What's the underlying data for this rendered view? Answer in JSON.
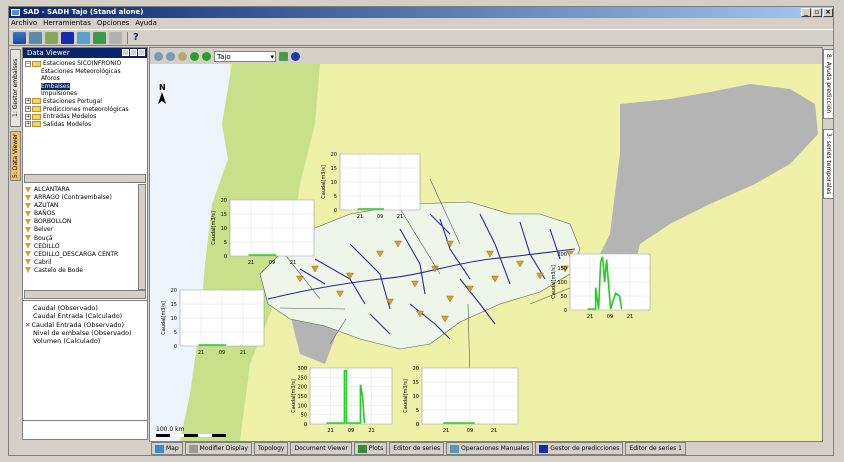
{
  "title": "SAD - SADH Tajo (Stand alone)",
  "menu": [
    "Archivo",
    "Herramientas",
    "Opciones",
    "Ayuda"
  ],
  "help_label": "?",
  "left_tabs": [
    "1: Gestor embalses",
    "5: Data Viewer"
  ],
  "right_tabs": [
    "8: Ayuda predicción",
    "3: series temporales"
  ],
  "data_viewer": {
    "title": "Data Viewer",
    "tree": [
      {
        "label": "Estaciones SICOINFRONIO",
        "expander": "−"
      },
      {
        "label": "Estaciones Meteorológicas"
      },
      {
        "label": "Aforos"
      },
      {
        "label": "Embalses",
        "selected": true
      },
      {
        "label": "Impulsiones"
      },
      {
        "label": "Estaciones Portugal",
        "expander": "+"
      },
      {
        "label": "Predicciones meteorológicas",
        "expander": "+"
      },
      {
        "label": "Entradas Modelos",
        "expander": "+"
      },
      {
        "label": "Salidas Modelos",
        "expander": "+"
      }
    ],
    "stations": [
      "ALCANTARA",
      "ARRAGO (Contraembalse)",
      "AZUTAN",
      "BAÑOS",
      "BORBOLLON",
      "Belver",
      "Bouçã",
      "CEDILLO",
      "CEDILLO_DESCARGA CENTR",
      "Cabril",
      "Castelo de Bode"
    ],
    "variables": [
      {
        "label": "Caudal (Observado)",
        "checked": false
      },
      {
        "label": "Caudal Entrada (Calculado)",
        "checked": false
      },
      {
        "label": "Caudal Entrada (Observado)",
        "checked": true,
        "mark": "✕"
      },
      {
        "label": "Nivel de embalse (Observado)",
        "checked": false
      },
      {
        "label": "Volumen (Calculado)",
        "checked": false
      }
    ]
  },
  "map": {
    "region_select": "Tajo",
    "north_label": "N",
    "scale_label": "100.0 km",
    "colors": {
      "sea": "#eef4fb",
      "land_yellow": "#eef2a8",
      "land_green": "#c8e08a",
      "gray": "#b4b4b4",
      "basin": "#eef6ea",
      "river": "#2a2a9a",
      "station": "#d9a030"
    },
    "ylabel": "Caudal[m3/s]",
    "insets": [
      {
        "yticks": [
          "0",
          "5",
          "10",
          "15",
          "20"
        ],
        "xticks": [
          "21",
          "09",
          "21"
        ],
        "kind": "flat"
      },
      {
        "yticks": [
          "0",
          "5",
          "10",
          "15",
          "20"
        ],
        "xticks": [
          "21",
          "09",
          "21"
        ],
        "kind": "flat"
      },
      {
        "yticks": [
          "0",
          "50",
          "100",
          "150",
          "200"
        ],
        "xticks": [
          "21",
          "09",
          "21"
        ],
        "kind": "spiky"
      },
      {
        "yticks": [
          "0",
          "5",
          "10",
          "15",
          "20"
        ],
        "xticks": [
          "21",
          "09",
          "21"
        ],
        "kind": "flat"
      },
      {
        "yticks": [
          "0",
          "50",
          "100",
          "150",
          "200",
          "250",
          "300"
        ],
        "xticks": [
          "21",
          "09",
          "21"
        ],
        "kind": "spike"
      },
      {
        "yticks": [
          "0",
          "5",
          "10",
          "15",
          "20"
        ],
        "xticks": [
          "21",
          "09",
          "21"
        ],
        "kind": "flat"
      }
    ]
  },
  "bottom_tabs": [
    "Map",
    "Modifier Display",
    "Topology",
    "Document Viewer",
    "Plots",
    "Editor de series",
    "Operaciones Manuales",
    "Gestor de predicciones",
    "Editor de series 1"
  ]
}
